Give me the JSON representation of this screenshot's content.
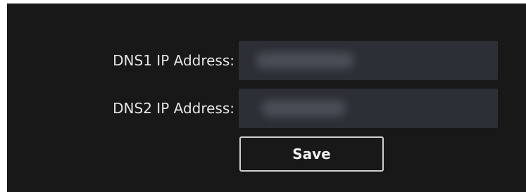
{
  "form": {
    "dns1": {
      "label": "DNS1 IP Address:",
      "value": ""
    },
    "dns2": {
      "label": "DNS2 IP Address:",
      "value": ""
    },
    "save_label": "Save"
  },
  "colors": {
    "panel_bg": "#181818",
    "field_bg": "#2c2f35",
    "text": "#e6e6e6",
    "button_border": "#cfcfcf"
  }
}
